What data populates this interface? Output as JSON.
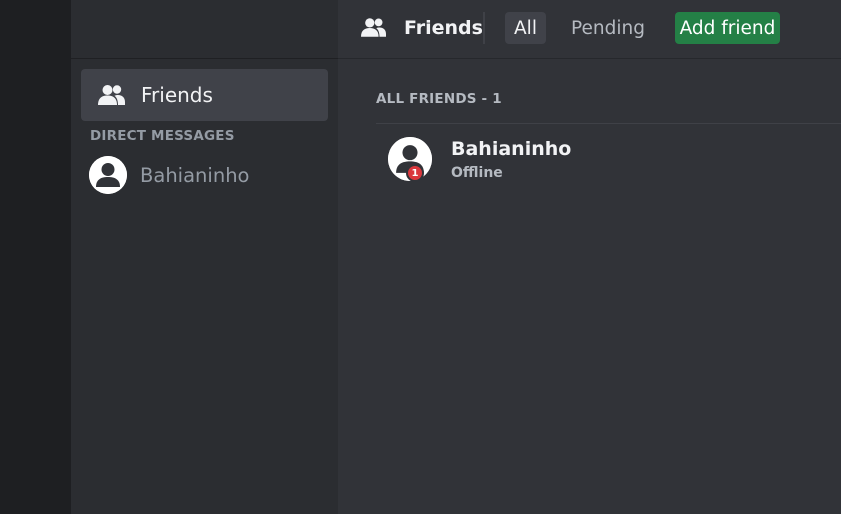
{
  "sidebar": {
    "friends_label": "Friends",
    "friends_icon": "friends-icon",
    "dm_header": "DIRECT MESSAGES",
    "dms": [
      {
        "name": "Bahianinho",
        "avatar_icon": "user-avatar-icon"
      }
    ]
  },
  "topbar": {
    "icon": "friends-icon",
    "title": "Friends",
    "tabs": [
      {
        "label": "All",
        "selected": true
      },
      {
        "label": "Pending",
        "selected": false
      },
      {
        "label": "Add friend",
        "selected": false
      }
    ]
  },
  "main": {
    "count_header": "ALL FRIENDS - 1",
    "friends": [
      {
        "name": "Bahianinho",
        "status": "Offline",
        "badge": "1",
        "avatar_icon": "user-avatar-icon"
      }
    ]
  },
  "colors": {
    "rail": "#1e1f22",
    "sidebar": "#2b2d31",
    "main": "#313338",
    "selected": "#404249",
    "accent_green": "#248046",
    "badge_red": "#da373c"
  }
}
